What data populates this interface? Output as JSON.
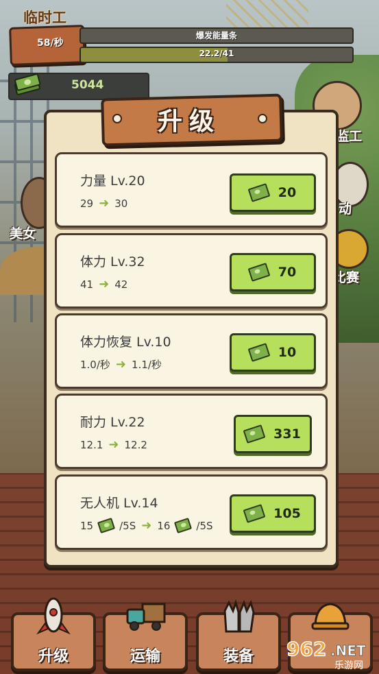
{
  "hud": {
    "player_name": "临时工",
    "earn_rate": "58/秒",
    "bar_top_label": "爆发能量条",
    "bar_top_fill": 0.0,
    "bar_bottom_label": "22.2/41",
    "bar_bottom_fill": 0.54,
    "money": "5044"
  },
  "side": {
    "boss_label": "监工",
    "beauty_label": "美女",
    "right_label_2": "动",
    "right_label_3": "比赛"
  },
  "dialog": {
    "title": "升级",
    "items": [
      {
        "name": "力量 Lv.20",
        "from": "29",
        "to": "30",
        "price": "20"
      },
      {
        "name": "体力 Lv.32",
        "from": "41",
        "to": "42",
        "price": "70"
      },
      {
        "name": "体力恢复 Lv.10",
        "from": "1.0/秒",
        "to": "1.1/秒",
        "price": "10"
      },
      {
        "name": "耐力 Lv.22",
        "from": "12.1",
        "to": "12.2",
        "price": "331"
      },
      {
        "name": "无人机 Lv.14",
        "from": "15",
        "from_unit": "/5S",
        "to": "16",
        "to_unit": "/5S",
        "price": "105"
      }
    ]
  },
  "nav": {
    "upgrade": "升级",
    "transport": "运输",
    "equip": "装备",
    "helmet": ""
  },
  "watermark": {
    "brand": "962",
    "suffix": ".NET",
    "sub": "乐游网"
  }
}
